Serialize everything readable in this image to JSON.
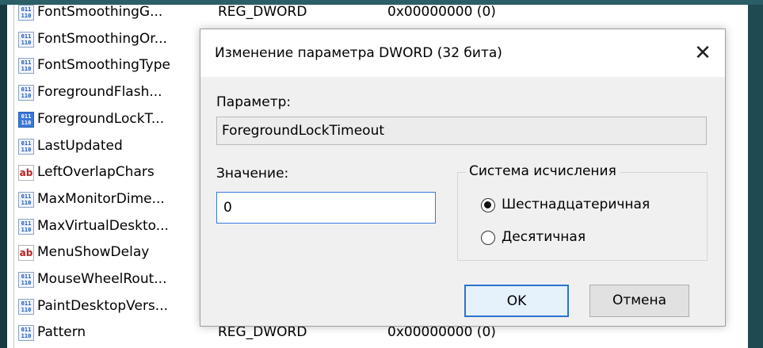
{
  "registry": {
    "rows": [
      {
        "name": "FontSmoothingG...",
        "type": "REG_DWORD",
        "data": "0x00000000 (0)",
        "icon": "binary-icon"
      },
      {
        "name": "FontSmoothingOr...",
        "type": "",
        "data": "",
        "icon": "binary-icon"
      },
      {
        "name": "FontSmoothingType",
        "type": "",
        "data": "",
        "icon": "binary-icon"
      },
      {
        "name": "ForegroundFlash...",
        "type": "",
        "data": "",
        "icon": "binary-icon"
      },
      {
        "name": "ForegroundLockT...",
        "type": "",
        "data": "",
        "icon": "binary-icon-selected"
      },
      {
        "name": "LastUpdated",
        "type": "",
        "data": "",
        "icon": "binary-icon"
      },
      {
        "name": "LeftOverlapChars",
        "type": "",
        "data": "",
        "icon": "string-icon"
      },
      {
        "name": "MaxMonitorDime...",
        "type": "",
        "data": "",
        "icon": "binary-icon"
      },
      {
        "name": "MaxVirtualDeskto...",
        "type": "",
        "data": "",
        "icon": "binary-icon"
      },
      {
        "name": "MenuShowDelay",
        "type": "",
        "data": "",
        "icon": "string-icon"
      },
      {
        "name": "MouseWheelRout...",
        "type": "",
        "data": "",
        "icon": "binary-icon"
      },
      {
        "name": "PaintDesktopVers...",
        "type": "",
        "data": "",
        "icon": "binary-icon"
      },
      {
        "name": "Pattern",
        "type": "REG_DWORD",
        "data": "0x00000000 (0)",
        "icon": "binary-icon"
      }
    ],
    "binary_glyph": "011\n110",
    "string_glyph": "ab"
  },
  "dialog": {
    "title": "Изменение параметра DWORD (32 бита)",
    "close_glyph": "✕",
    "param_label": "Параметр:",
    "param_value": "ForegroundLockTimeout",
    "value_label": "Значение:",
    "value": "0",
    "base_group_label": "Система исчисления",
    "radio_hex": "Шестнадцатеричная",
    "radio_dec": "Десятичная",
    "selected_base": "hex",
    "ok_label": "OK",
    "cancel_label": "Отмена"
  },
  "colors": {
    "background": "#1f4a52",
    "accent": "#2a73d1"
  }
}
